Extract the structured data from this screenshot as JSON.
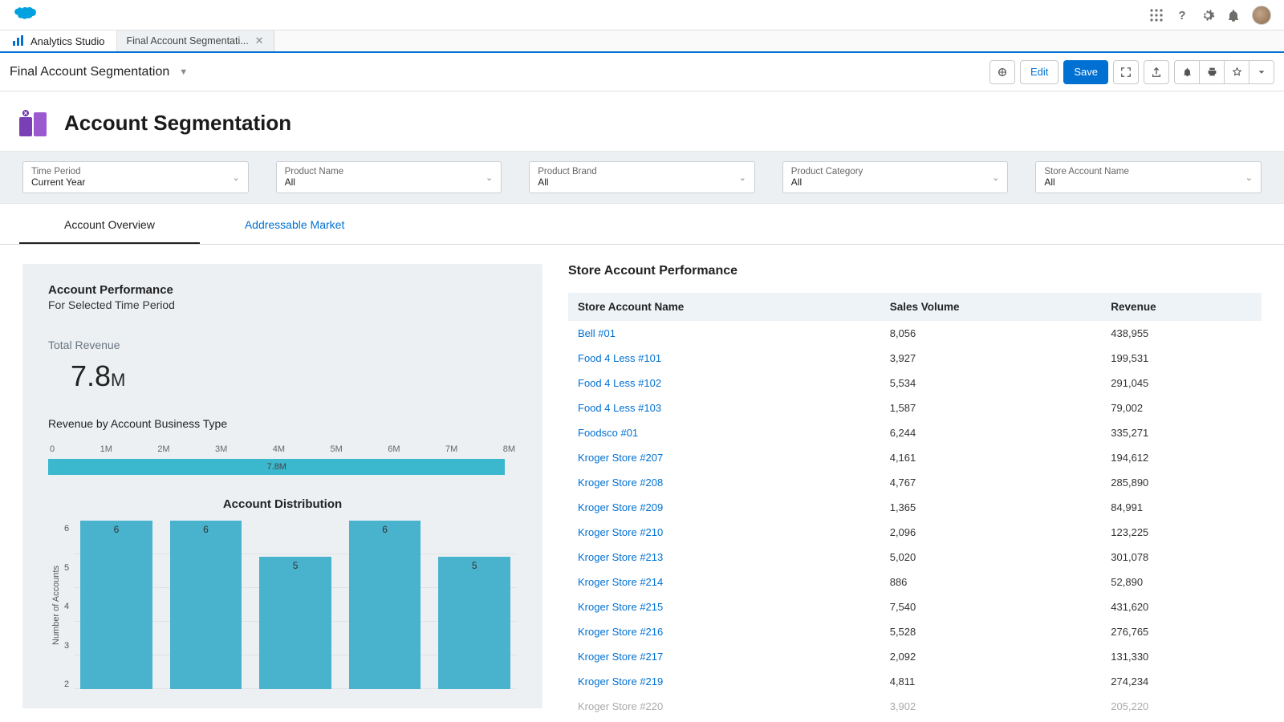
{
  "header": {
    "workspace_tab": "Analytics Studio",
    "sub_tab": "Final Account Segmentati...",
    "page_name": "Final Account Segmentation",
    "edit_label": "Edit",
    "save_label": "Save"
  },
  "title": "Account Segmentation",
  "filters": [
    {
      "label": "Time Period",
      "value": "Current Year"
    },
    {
      "label": "Product Name",
      "value": "All"
    },
    {
      "label": "Product Brand",
      "value": "All"
    },
    {
      "label": "Product Category",
      "value": "All"
    },
    {
      "label": "Store Account Name",
      "value": "All"
    }
  ],
  "content_tabs": {
    "active": "Account Overview",
    "inactive": "Addressable Market"
  },
  "account_performance": {
    "title": "Account Performance",
    "subtitle": "For Selected Time Period",
    "total_revenue_label": "Total Revenue",
    "total_revenue_value": "7.8",
    "total_revenue_suffix": "M",
    "revenue_by_type_label": "Revenue by Account Business Type",
    "distribution_title": "Account Distribution",
    "dist_ylabel": "Number of Accounts"
  },
  "chart_data": {
    "hbar": {
      "type": "bar",
      "orientation": "horizontal",
      "ticks": [
        "0",
        "1M",
        "2M",
        "3M",
        "4M",
        "5M",
        "6M",
        "7M",
        "8M"
      ],
      "xlim": [
        0,
        8
      ],
      "value": 7.8,
      "value_label": "7.8M"
    },
    "distribution": {
      "type": "bar",
      "title": "Account Distribution",
      "ylabel": "Number of Accounts",
      "ylim": [
        2,
        6
      ],
      "yticks": [
        "6",
        "5",
        "4",
        "3",
        "2"
      ],
      "values": [
        6,
        6,
        5,
        6,
        5
      ]
    }
  },
  "store_table": {
    "title": "Store Account Performance",
    "columns": [
      "Store Account Name",
      "Sales Volume",
      "Revenue"
    ],
    "rows": [
      {
        "name": "Bell #01",
        "volume": "8,056",
        "revenue": "438,955"
      },
      {
        "name": "Food 4 Less #101",
        "volume": "3,927",
        "revenue": "199,531"
      },
      {
        "name": "Food 4 Less #102",
        "volume": "5,534",
        "revenue": "291,045"
      },
      {
        "name": "Food 4 Less #103",
        "volume": "1,587",
        "revenue": "79,002"
      },
      {
        "name": "Foodsco #01",
        "volume": "6,244",
        "revenue": "335,271"
      },
      {
        "name": "Kroger Store #207",
        "volume": "4,161",
        "revenue": "194,612"
      },
      {
        "name": "Kroger Store #208",
        "volume": "4,767",
        "revenue": "285,890"
      },
      {
        "name": "Kroger Store #209",
        "volume": "1,365",
        "revenue": "84,991"
      },
      {
        "name": "Kroger Store #210",
        "volume": "2,096",
        "revenue": "123,225"
      },
      {
        "name": "Kroger Store #213",
        "volume": "5,020",
        "revenue": "301,078"
      },
      {
        "name": "Kroger Store #214",
        "volume": "886",
        "revenue": "52,890"
      },
      {
        "name": "Kroger Store #215",
        "volume": "7,540",
        "revenue": "431,620"
      },
      {
        "name": "Kroger Store #216",
        "volume": "5,528",
        "revenue": "276,765"
      },
      {
        "name": "Kroger Store #217",
        "volume": "2,092",
        "revenue": "131,330"
      },
      {
        "name": "Kroger Store #219",
        "volume": "4,811",
        "revenue": "274,234"
      },
      {
        "name": "Kroger Store #220",
        "volume": "3,902",
        "revenue": "205,220"
      }
    ]
  }
}
